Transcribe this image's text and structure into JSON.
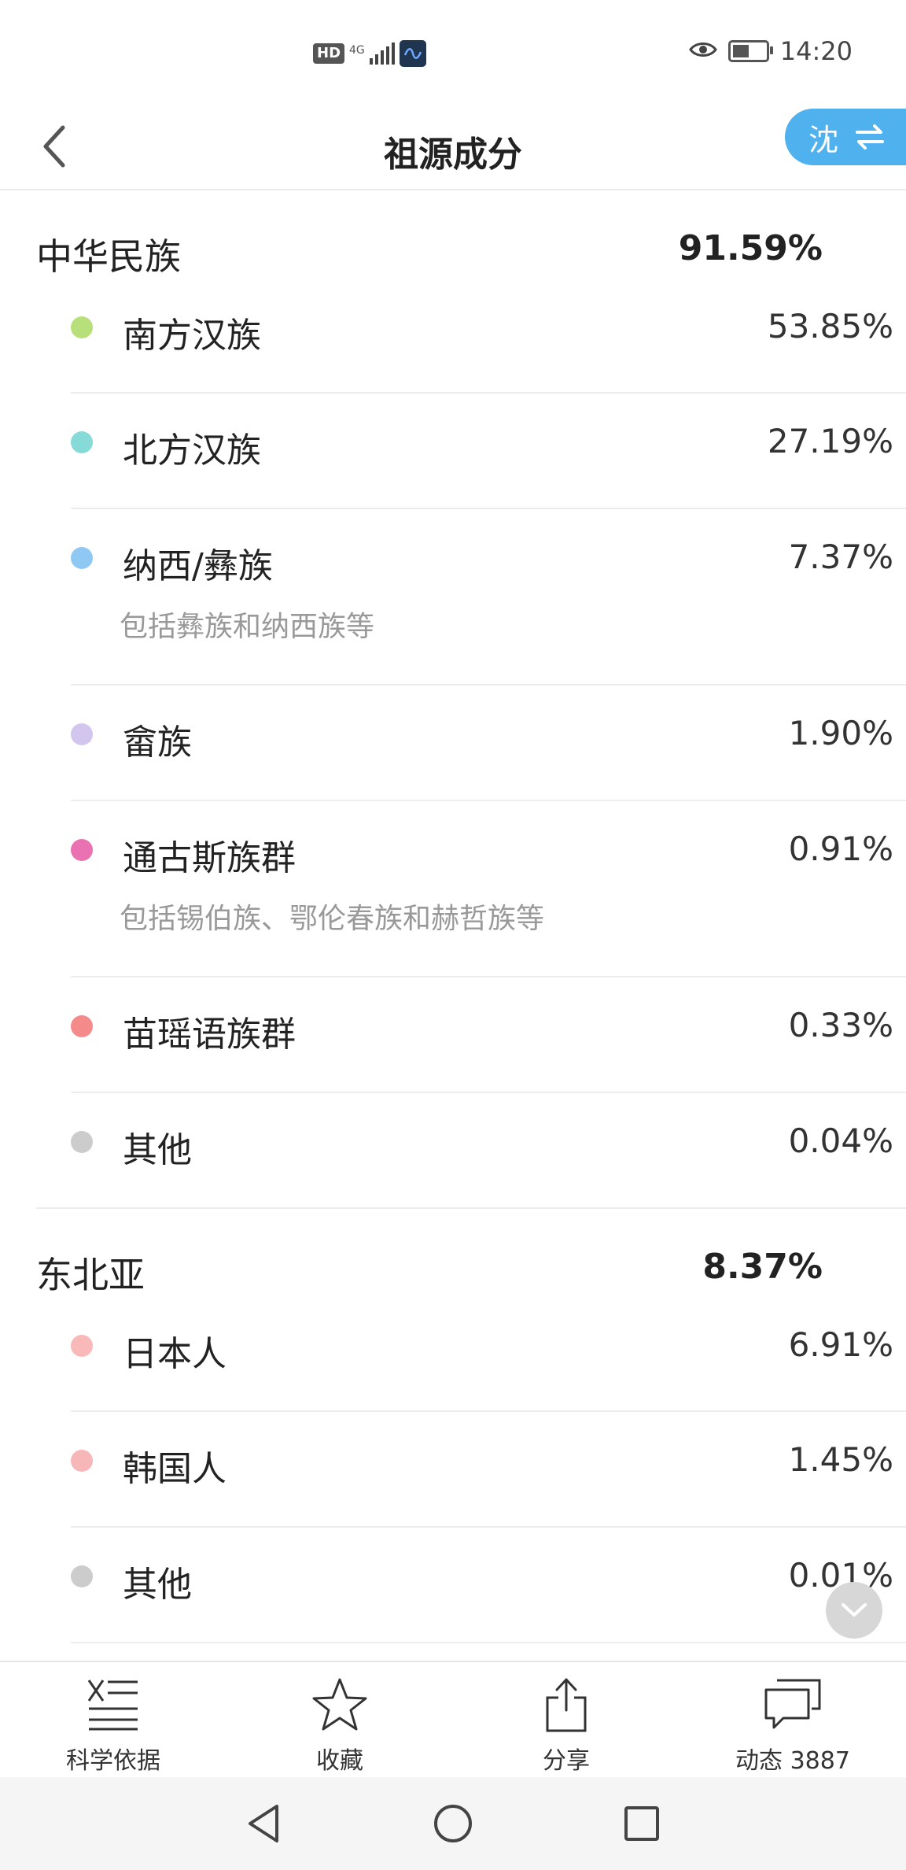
{
  "status_bar": {
    "hd": "HD",
    "network": "4G",
    "time": "14:20"
  },
  "header": {
    "title": "祖源成分",
    "switch_label": "沈",
    "accent_color": "#4fb1ee"
  },
  "groups": [
    {
      "name": "中华民族",
      "percent": "91.59%",
      "items": [
        {
          "name": "南方汉族",
          "percent": "53.85%",
          "color": "#b8e07a"
        },
        {
          "name": "北方汉族",
          "percent": "27.19%",
          "color": "#86dbd8"
        },
        {
          "name": "纳西/彝族",
          "percent": "7.37%",
          "color": "#8fc8f2",
          "sub": "包括彝族和纳西族等"
        },
        {
          "name": "畲族",
          "percent": "1.90%",
          "color": "#d2c6ef"
        },
        {
          "name": "通古斯族群",
          "percent": "0.91%",
          "color": "#ea72b2",
          "sub": "包括锡伯族、鄂伦春族和赫哲族等"
        },
        {
          "name": "苗瑶语族群",
          "percent": "0.33%",
          "color": "#f58a8a"
        },
        {
          "name": "其他",
          "percent": "0.04%",
          "color": "#cccccc"
        }
      ]
    },
    {
      "name": "东北亚",
      "percent": "8.37%",
      "items": [
        {
          "name": "日本人",
          "percent": "6.91%",
          "color": "#f9b9b9"
        },
        {
          "name": "韩国人",
          "percent": "1.45%",
          "color": "#f7b6b8"
        },
        {
          "name": "其他",
          "percent": "0.01%",
          "color": "#cccccc"
        }
      ]
    }
  ],
  "toolbar": {
    "science": "科学依据",
    "favorite": "收藏",
    "share": "分享",
    "activity": "动态 3887"
  }
}
